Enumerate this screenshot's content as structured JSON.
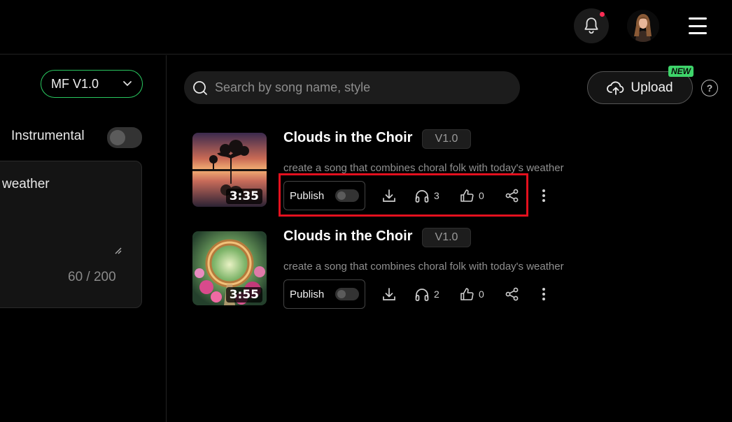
{
  "header": {
    "notification_icon": "bell-icon",
    "avatar_alt": "user avatar",
    "menu_icon": "hamburger-icon"
  },
  "sidebar": {
    "model_select_value": "MF V1.0",
    "instrumental_label": "Instrumental",
    "lyrics_text": "weather",
    "char_counter": "60 / 200"
  },
  "main": {
    "search_placeholder": "Search by song name, style",
    "upload_label": "Upload",
    "new_badge": "NEW",
    "help_label": "?",
    "songs": [
      {
        "title": "Clouds in the Choir",
        "version": "V1.0",
        "description": "create a song that combines choral folk with today's weather",
        "duration": "3:35",
        "publish_label": "Publish",
        "plays": "3",
        "likes": "0"
      },
      {
        "title": "Clouds in the Choir",
        "version": "V1.0",
        "description": "create a song that combines choral folk with today's weather",
        "duration": "3:55",
        "publish_label": "Publish",
        "plays": "2",
        "likes": "0"
      }
    ]
  },
  "colors": {
    "accent_green": "#29c75f",
    "highlight_red": "#e3101e",
    "notification_dot": "#ff2d55"
  }
}
